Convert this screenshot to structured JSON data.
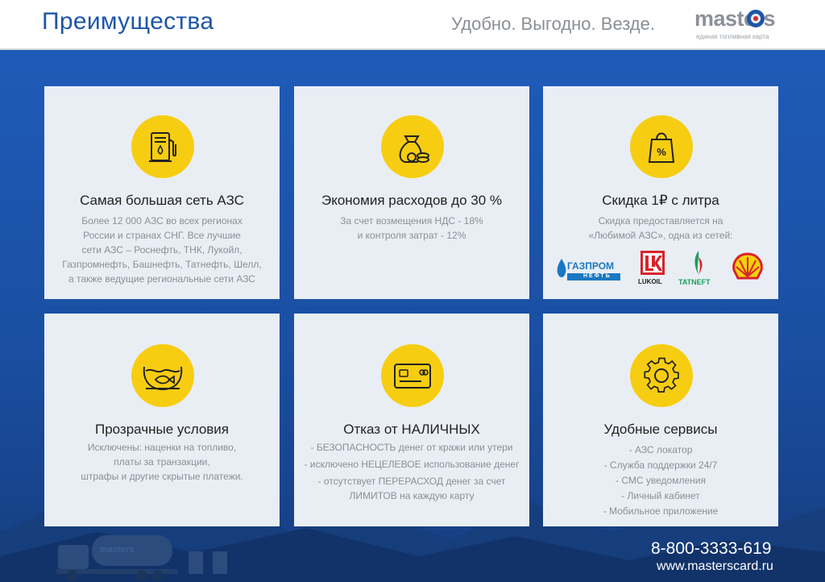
{
  "header": {
    "title": "Преимущества",
    "tagline": "Удобно. Выгодно. Везде.",
    "logo": {
      "word": "masters",
      "subtitle": "единая топливная карта"
    }
  },
  "colors": {
    "accent": "#1e56a8",
    "icon_circle": "#f7cd12",
    "card_bg": "#e9eef5",
    "bg_blue": "#1a4fa0"
  },
  "cards": [
    {
      "icon": "fuel-pump-icon",
      "title": "Самая большая сеть АЗС",
      "lines": [
        "Более 12 000 АЗС во всех регионах",
        "России и странах СНГ. Все лучшие",
        "сети АЗС – Роснефть, ТНК, Лукойл,",
        "Газпромнефть, Башнефть, Татнефть, Шелл,",
        "а также ведущие региональные сети АЗС"
      ]
    },
    {
      "icon": "money-bag-icon",
      "title": "Экономия расходов до 30 %",
      "lines": [
        "За счет возмещения НДС - 18%",
        "и контроля затрат - 12%"
      ]
    },
    {
      "icon": "shopping-bag-percent-icon",
      "title": "Скидка 1₽ с литра",
      "lines": [
        "Скидка предоставляется на",
        "«Любимой АЗС», одна из сетей:"
      ],
      "brands": {
        "gazprom": "ГАЗПРОМ",
        "gazprom_sub": "НЕФТЬ",
        "lukoil": "LUKOIL",
        "tatneft": "TATNEFT"
      }
    },
    {
      "icon": "aquarium-icon",
      "title": "Прозрачные условия",
      "lines": [
        "Исключены: наценки на топливо,",
        "платы за транзакции,",
        "штрафы и другие скрытые платежи."
      ]
    },
    {
      "icon": "credit-card-icon",
      "title": "Отказ от НАЛИЧНЫХ",
      "lines": [
        "- БЕЗОПАСНОСТЬ денег от кражи или утери",
        "- исключено НЕЦЕЛЕВОЕ использование денег",
        "- отсутствует ПЕРЕРАСХОД денег за счет",
        "ЛИМИТОВ на каждую карту"
      ]
    },
    {
      "icon": "gear-icon",
      "title": "Удобные сервисы",
      "lines": [
        "- АЗС локатор",
        "- Служба поддержки 24/7",
        "- СМС уведомления",
        "- Личный кабинет",
        "- Мобильное приложение"
      ]
    }
  ],
  "footer": {
    "phone": "8-800-3333-619",
    "url": "www.masterscard.ru",
    "truck_label": "masters"
  }
}
